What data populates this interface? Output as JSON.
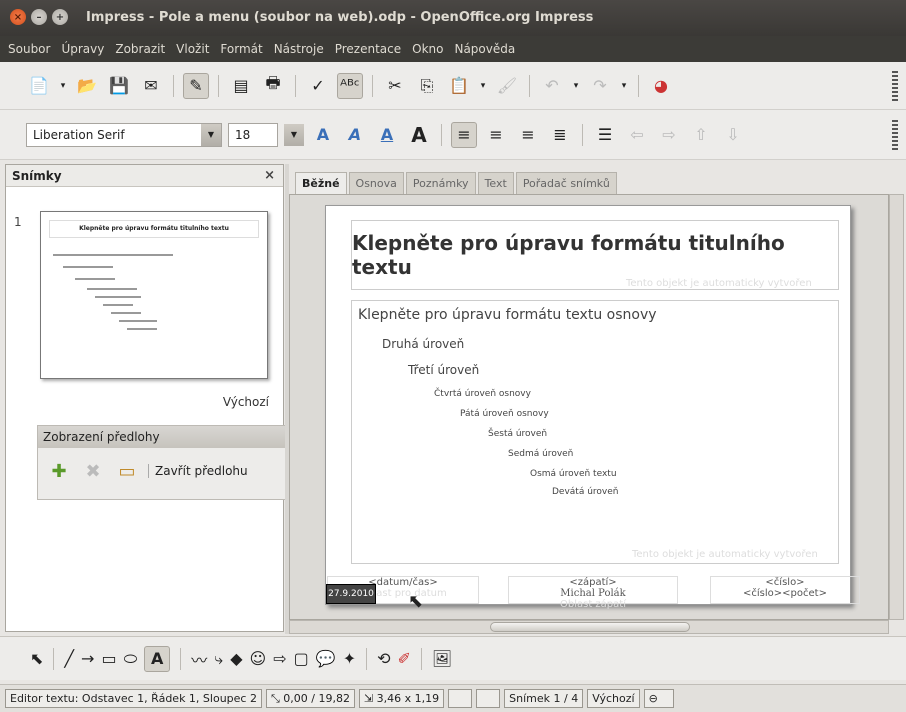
{
  "window": {
    "title": "Impress - Pole a menu (soubor na web).odp - OpenOffice.org Impress"
  },
  "menu": [
    "Soubor",
    "Úpravy",
    "Zobrazit",
    "Vložit",
    "Formát",
    "Nástroje",
    "Prezentace",
    "Okno",
    "Nápověda"
  ],
  "format_toolbar": {
    "font_name": "Liberation Serif",
    "font_size": "18"
  },
  "slides_panel": {
    "title": "Snímky",
    "close": "×",
    "slide_number": "1",
    "slide_name": "Výchozí",
    "thumb_title": "Klepněte pro úpravu formátu titulního textu"
  },
  "master_panel": {
    "title": "Zobrazení předlohy",
    "close_label": "Zavřít předlohu"
  },
  "tabs": [
    "Běžné",
    "Osnova",
    "Poznámky",
    "Text",
    "Pořadač snímků"
  ],
  "slide": {
    "title": "Klepněte pro úpravu formátu titulního textu",
    "title_hint": "Tento objekt je automaticky vytvořen",
    "levels": [
      "Klepněte pro úpravu formátu textu osnovy",
      "Druhá úroveň",
      "Třetí úroveň",
      "Čtvrtá úroveň osnovy",
      "Pátá úroveň osnovy",
      "Šestá úroveň",
      "Sedmá úroveň",
      "Osmá úroveň textu",
      "Devátá úroveň"
    ],
    "body_hint": "Tento objekt je automaticky vytvořen",
    "footer_date_label": "<datum/čas>",
    "footer_date_value": "27.9.2010",
    "footer_date_area": "Oblast pro datum",
    "footer_center_label": "<zápatí>",
    "footer_center_value": "Michal Polák",
    "footer_center_area": "Oblast zápatí",
    "footer_num_label": "<číslo>",
    "footer_num_value": "<číslo><počet>"
  },
  "statusbar": {
    "mode": "Editor textu: Odstavec 1, Řádek 1, Sloupec 2",
    "position": "0,00 / 19,82",
    "size": "3,46 x 1,19",
    "slide": "Snímek 1 / 4",
    "layout": "Výchozí"
  },
  "colors": {
    "titlebar": "#3c3b37",
    "close_button": "#e0582a",
    "toolbar": "#edecea"
  }
}
